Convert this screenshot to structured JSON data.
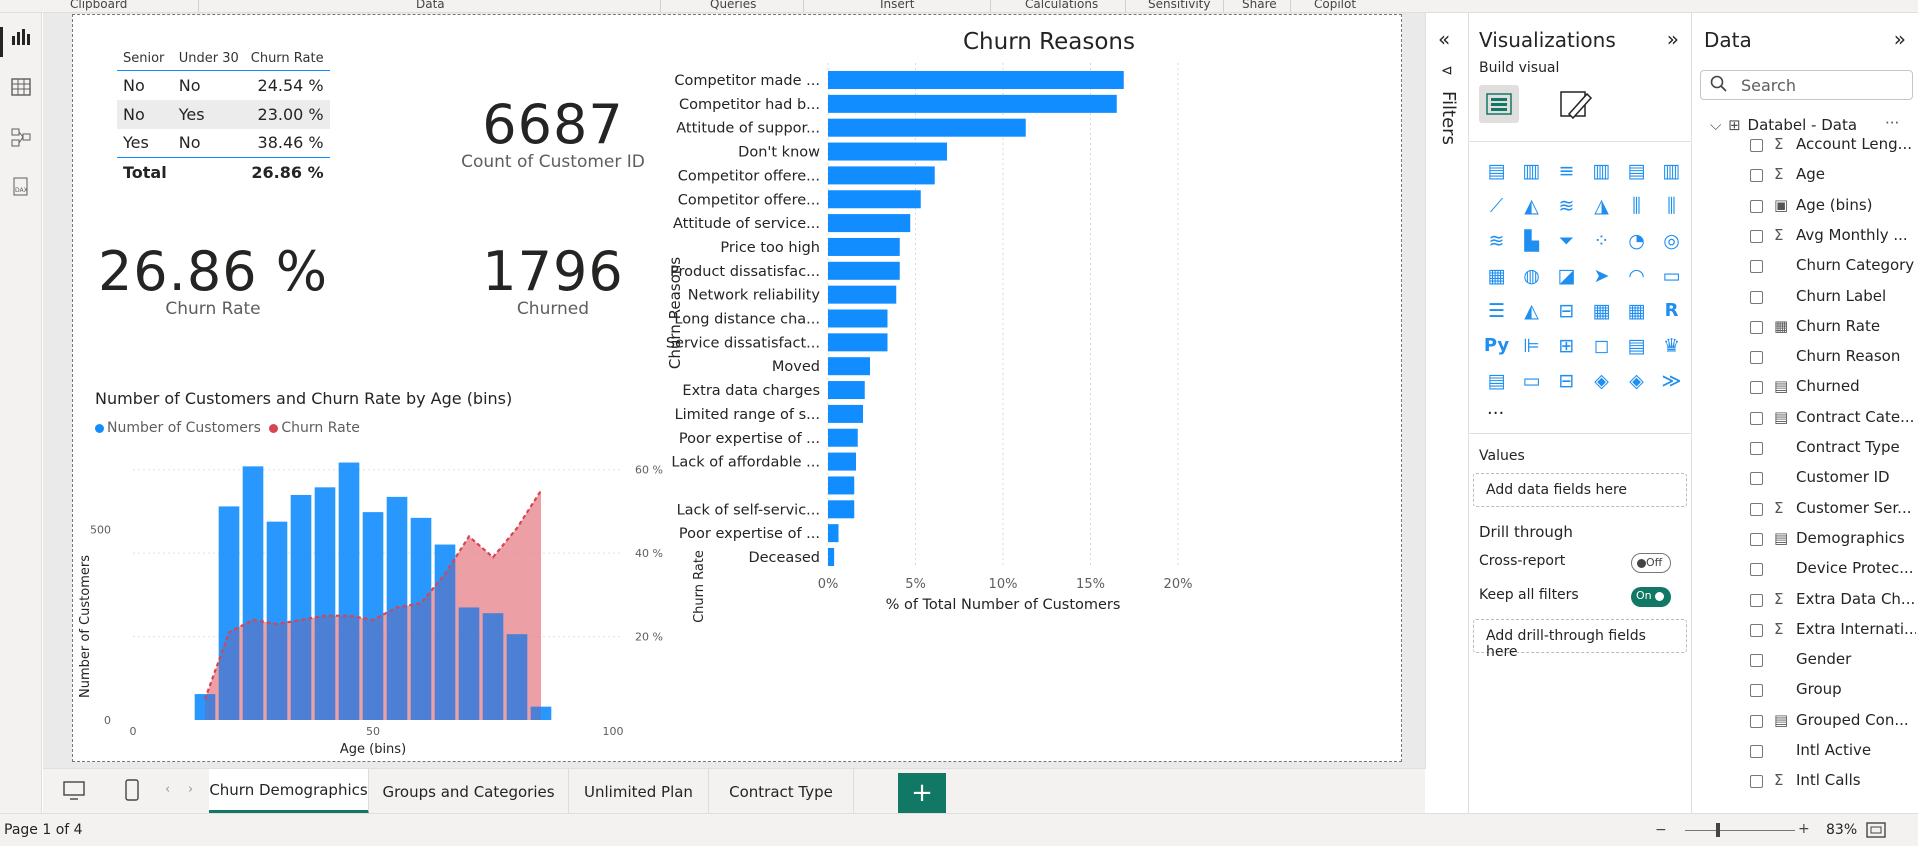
{
  "ribbon": {
    "groups": [
      "Clipboard",
      "Data",
      "Queries",
      "Insert",
      "Calculations",
      "Sensitivity",
      "Share",
      "Copilot"
    ]
  },
  "leftnav": {
    "icons": [
      "report-view-icon",
      "table-view-icon",
      "model-view-icon",
      "dax-query-icon"
    ]
  },
  "matrix": {
    "headers": [
      "Senior",
      "Under 30",
      "Churn Rate"
    ],
    "rows": [
      [
        "No",
        "No",
        "24.54 %"
      ],
      [
        "No",
        "Yes",
        "23.00 %"
      ],
      [
        "Yes",
        "No",
        "38.46 %"
      ]
    ],
    "total_label": "Total",
    "total_value": "26.86 %"
  },
  "cards": {
    "count": {
      "value": "6687",
      "label": "Count of Customer ID"
    },
    "churn_rate": {
      "value": "26.86 %",
      "label": "Churn Rate"
    },
    "churned": {
      "value": "1796",
      "label": "Churned"
    }
  },
  "combo_chart": {
    "title": "Number of Customers and Churn Rate by Age (bins)",
    "legend": [
      "Number of Customers",
      "Churn Rate"
    ],
    "xlabel": "Age (bins)",
    "ylabel_left": "Number of Customers",
    "ylabel_right": "Churn Rate",
    "x_ticks": [
      "0",
      "50",
      "100"
    ],
    "y_ticks_left": [
      "0",
      "500"
    ],
    "y_ticks_right": [
      "20 %",
      "40 %",
      "60 %"
    ],
    "colors": {
      "bars": "#118dff",
      "line": "#d64550",
      "area": "#eea3a8"
    }
  },
  "bar_chart": {
    "title": "Churn Reasons",
    "ylabel": "Churn Reasons",
    "xlabel": "% of Total Number of Customers",
    "x_ticks": [
      "0%",
      "5%",
      "10%",
      "15%",
      "20%"
    ],
    "color": "#118dff"
  },
  "chart_data": [
    {
      "type": "bar",
      "title": "Churn Reasons",
      "xlabel": "% of Total Number of Customers",
      "ylabel": "Churn Reasons",
      "orientation": "horizontal",
      "xlim": [
        0,
        20
      ],
      "categories": [
        "Competitor made ...",
        "Competitor had b...",
        "Attitude of suppor...",
        "Don't know",
        "Competitor offere...",
        "Competitor offere...",
        "Attitude of service...",
        "Price too high",
        "Product dissatisfac...",
        "Network reliability",
        "Long distance cha...",
        "Service dissatisfact...",
        "Moved",
        "Extra data charges",
        "Limited range of s...",
        "Poor expertise of ...",
        "Lack of affordable ...",
        "",
        "Lack of self-servic...",
        "Poor expertise of ...",
        "Deceased"
      ],
      "values": [
        16.9,
        16.5,
        11.3,
        6.8,
        6.1,
        5.3,
        4.7,
        4.1,
        4.1,
        3.9,
        3.4,
        3.4,
        2.4,
        2.1,
        2.0,
        1.7,
        1.6,
        1.5,
        1.5,
        0.6,
        0.35
      ]
    },
    {
      "type": "bar+line",
      "title": "Number of Customers and Churn Rate by Age (bins)",
      "xlabel": "Age (bins)",
      "ylabel": "Number of Customers",
      "y2label": "Churn Rate",
      "xlim": [
        0,
        100
      ],
      "ylim": [
        0,
        700
      ],
      "y2lim": [
        0,
        64
      ],
      "x": [
        15,
        20,
        25,
        30,
        35,
        40,
        45,
        50,
        55,
        60,
        65,
        70,
        75,
        80,
        85
      ],
      "series": [
        {
          "name": "Number of Customers",
          "values": [
            68,
            560,
            665,
            520,
            590,
            610,
            675,
            545,
            585,
            530,
            460,
            295,
            280,
            225,
            35
          ]
        },
        {
          "name": "Churn Rate",
          "values": [
            5,
            21,
            24,
            23,
            24,
            25,
            25,
            24,
            27,
            28,
            35,
            44,
            39,
            46,
            55
          ]
        }
      ]
    }
  ],
  "filters": {
    "label": "Filters"
  },
  "viz_pane": {
    "title": "Visualizations",
    "build_visual": "Build visual",
    "icons": [
      "stacked-bar-icon",
      "stacked-column-icon",
      "clustered-bar-icon",
      "clustered-column-icon",
      "100-bar-icon",
      "100-column-icon",
      "line-icon",
      "area-icon",
      "stacked-area-icon",
      "100-area-icon",
      "line-column-icon",
      "line-clustered-icon",
      "ribbon-icon",
      "waterfall-icon",
      "funnel-icon",
      "scatter-icon",
      "pie-icon",
      "donut-icon",
      "treemap-icon",
      "map-icon",
      "filled-map-icon",
      "azure-map-icon",
      "gauge-icon",
      "card-icon",
      "multirow-card-icon",
      "kpi-icon",
      "slicer-icon",
      "table-icon",
      "matrix-icon",
      "r-visual-icon",
      "python-visual-icon",
      "key-influencers-icon",
      "decomposition-tree-icon",
      "qa-icon",
      "narrative-icon",
      "goals-icon",
      "paginated-icon",
      "card-new-icon",
      "slicer-new-icon",
      "power-apps-icon",
      "power-automate-icon",
      "more-visuals-icon"
    ],
    "values_label": "Values",
    "values_placeholder": "Add data fields here",
    "drill_label": "Drill through",
    "cross_report": "Cross-report",
    "cross_report_state": "Off",
    "keep_filters": "Keep all filters",
    "keep_filters_state": "On",
    "drill_placeholder": "Add drill-through fields here"
  },
  "data_pane": {
    "title": "Data",
    "search_placeholder": "Search",
    "table_name": "Databel - Data",
    "fields": [
      {
        "name": "Account Leng...",
        "icon": "Σ"
      },
      {
        "name": "Age",
        "icon": "Σ"
      },
      {
        "name": "Age (bins)",
        "icon": "▣"
      },
      {
        "name": "Avg Monthly ...",
        "icon": "Σ"
      },
      {
        "name": "Churn Category",
        "icon": ""
      },
      {
        "name": "Churn Label",
        "icon": ""
      },
      {
        "name": "Churn Rate",
        "icon": "▦"
      },
      {
        "name": "Churn Reason",
        "icon": ""
      },
      {
        "name": "Churned",
        "icon": "▤"
      },
      {
        "name": "Contract Cate...",
        "icon": "▤"
      },
      {
        "name": "Contract Type",
        "icon": ""
      },
      {
        "name": "Customer ID",
        "icon": ""
      },
      {
        "name": "Customer Ser...",
        "icon": "Σ"
      },
      {
        "name": "Demographics",
        "icon": "▤"
      },
      {
        "name": "Device Protec...",
        "icon": ""
      },
      {
        "name": "Extra Data Ch...",
        "icon": "Σ"
      },
      {
        "name": "Extra Internati...",
        "icon": "Σ"
      },
      {
        "name": "Gender",
        "icon": ""
      },
      {
        "name": "Group",
        "icon": ""
      },
      {
        "name": "Grouped Con...",
        "icon": "▤"
      },
      {
        "name": "Intl Active",
        "icon": ""
      },
      {
        "name": "Intl Calls",
        "icon": "Σ"
      }
    ]
  },
  "tabs": [
    "Churn Demographics",
    "Groups and Categories",
    "Unlimited Plan",
    "Contract Type"
  ],
  "status": {
    "page": "Page 1 of 4",
    "zoom": "83%"
  }
}
